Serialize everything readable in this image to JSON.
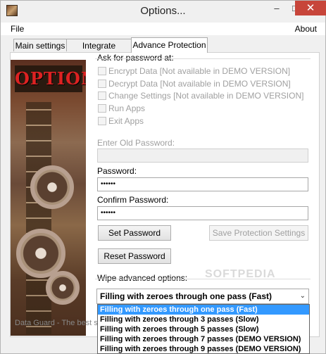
{
  "window": {
    "title": "Options..."
  },
  "titlebar": {
    "minimize": "–",
    "maximize": "□",
    "close": "✕"
  },
  "menu": {
    "file": "File",
    "about": "About"
  },
  "tabs": [
    {
      "label": "Main settings"
    },
    {
      "label": "Integrate settings"
    },
    {
      "label": "Advance Protection",
      "active": true
    }
  ],
  "image": {
    "logo_text": "OPTIONS"
  },
  "password": {
    "group_label": "Ask for password at:",
    "options": [
      {
        "label": "Encrypt Data [Not available in DEMO VERSION]",
        "checked": false,
        "enabled": false
      },
      {
        "label": "Decrypt Data [Not available in DEMO VERSION]",
        "checked": false,
        "enabled": false
      },
      {
        "label": "Change Settings [Not available in DEMO VERSION]",
        "checked": false,
        "enabled": false
      },
      {
        "label": "Run Apps",
        "checked": false,
        "enabled": false
      },
      {
        "label": "Exit Apps",
        "checked": false,
        "enabled": false
      }
    ],
    "old_password_label": "Enter Old Password:",
    "old_password_value": "",
    "password_label": "Password:",
    "password_value": "••••••",
    "confirm_label": "Confirm Password:",
    "confirm_value": "••••••",
    "set_button": "Set Password",
    "save_button": "Save Protection Settings",
    "reset_button": "Reset Password"
  },
  "wipe": {
    "label": "Wipe advanced options:",
    "selected": "Filling with zeroes through one pass (Fast)",
    "options": [
      "Filling with zeroes through one pass (Fast)",
      "Filling with zeroes through 3 passes (Slow)",
      "Filling with zeroes through 5 passes (Slow)",
      "Filling with zeroes through 7 passes (DEMO VERSION)",
      "Filling with zeroes through 9 passes (DEMO VERSION)"
    ]
  },
  "status": {
    "text": "Data Guard - The best s"
  },
  "watermark": {
    "text": "SOFTPEDIA"
  },
  "colors": {
    "selection": "#3399ff",
    "close": "#c7453a",
    "disabled_text": "#a0a0a0"
  }
}
